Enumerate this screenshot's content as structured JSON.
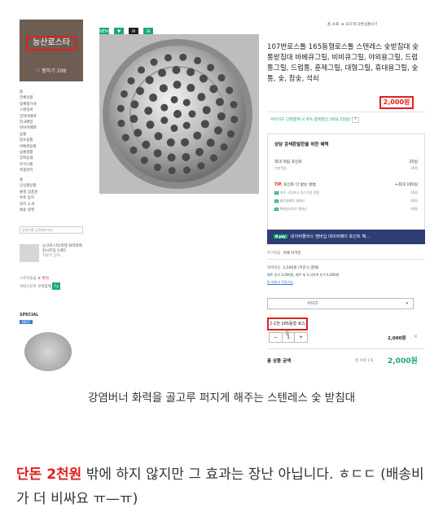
{
  "shop": {
    "name": "능산로스타",
    "favorites": "♡ 찜하기 208"
  },
  "sidebar": {
    "categories": [
      "홈",
      "전체상품",
      "업체별가게",
      "스탠딩바",
      "장작바베큐",
      "전국배달",
      "바이어혜택",
      "숯통",
      "업소용품",
      "바베큐용품",
      "숯불생활",
      "장화농협",
      "바구니통",
      "위생관리"
    ],
    "links": [
      "홈",
      "신상품상품",
      "불필 상품권",
      "톡톡 방지",
      "위치 소개",
      "배송 정책"
    ],
    "search_placeholder": "검색어를 입력해보세요",
    "product_snippet": "능산로스타(박행 화력바베 칼시트업 1세트",
    "product_snippet_price": "자료지 방지",
    "grade_label": "스토어등급",
    "grade_value": "파워",
    "service_label": "서비스만족",
    "service_value": "우대업체",
    "special_label": "SPECIAL",
    "best_label": "BEST"
  },
  "top_icons": [
    "NEW",
    "♥",
    "✉",
    "⊞"
  ],
  "topbar": "홈  소화: ★ 107개  다른상품보기",
  "product": {
    "title": "107번로스톨 165동형로스톨 스텐레스 숯받침대 숯통받침대 바베큐그릴, 비비큐그릴, 야외용그릴, 드럼통그릴, 드럼통, 훈제그릴, 대형그릴, 휴대용그릴, 숯통, 숯, 참숯, 석쇠",
    "price": "2,000원",
    "card_promo": "우리카드 간편결제 시 6% 결제할인 (최대 2천원)",
    "card_tag": "?"
  },
  "benefits": {
    "heading": "상담 검색환발한을 위한 혜택",
    "max_label": "최대 적립 포인트",
    "max_value": "20원",
    "basic_label": "기본적립",
    "basic_value": "20원",
    "tip_label": "TIP.",
    "tip_text": "포인트 더 받는 방법",
    "tip_value": "+최대 160원",
    "items": [
      {
        "badge": "N",
        "label": "포토 구입하고 후기 4일 적립",
        "value": "50원"
      },
      {
        "badge": "N",
        "label": "충전결제로 결제시",
        "value": "40원"
      },
      {
        "badge": "N",
        "label": "N마일리지로 결제시",
        "value": "40원"
      }
    ]
  },
  "npay": {
    "badge": "N pay",
    "text": "네이버플러스 멤버십 네이버페이 포인트 혜..."
  },
  "shipping": {
    "label": "추가적립",
    "value": "카페 지역천",
    "fee_label": "택배배송",
    "fee_value": "2,500원 (주문시 결제)",
    "note1": "제주 추가 3,000원, 제주 외 도서지역 추가 4,000원",
    "note2": "원 배송비 적용가능"
  },
  "option": {
    "select_label": "사이즈",
    "chosen": "2-1번 165동형 로스톨",
    "qty": "1",
    "line_price": "2,000원"
  },
  "total": {
    "label": "총 상품 금액",
    "qty": "총 수량 1개",
    "price": "2,000원"
  },
  "caption": "강염버너 화력을 골고루 퍼지게 해주는 스텐레스 숯 받침대",
  "paragraph": {
    "highlight": "단돈 2천원",
    "rest": " 밖에 하지 않지만 그 효과는 장난 아닙니다. ㅎㄷㄷ (배송비가 더 비싸요 ㅠ—ㅠ)"
  }
}
